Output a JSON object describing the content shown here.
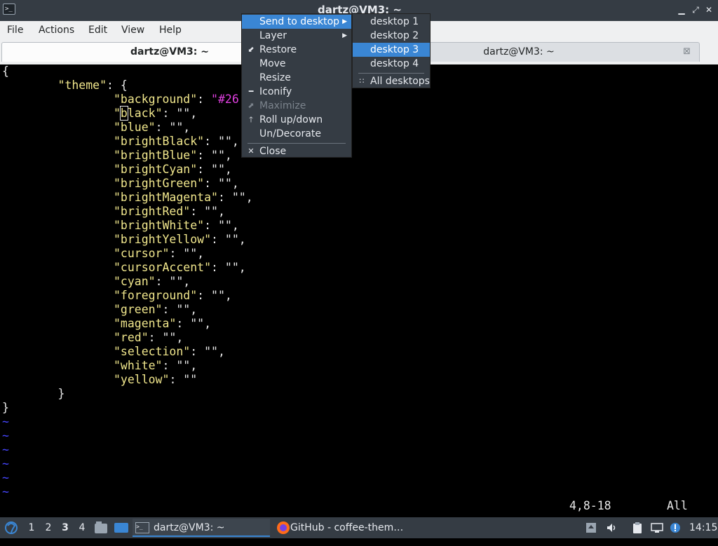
{
  "window": {
    "title": "dartz@VM3: ~",
    "app_icon_text": ">_",
    "controls": {
      "minimize": "▁",
      "maximize": "⤢",
      "close": "✕"
    }
  },
  "menubar": [
    "File",
    "Actions",
    "Edit",
    "View",
    "Help"
  ],
  "tabs": [
    {
      "label": "dartz@VM3: ~",
      "active": true
    },
    {
      "label": "dartz@VM3: ~",
      "active": false,
      "close": "⊠"
    }
  ],
  "editor": {
    "lines": {
      "l0": "{",
      "l1_key": "\"theme\"",
      "l1_rest": ": {",
      "l2_key": "\"background\"",
      "l2_sep": ": ",
      "l2_val": "\"#26",
      "l3_q": "\"",
      "l3_cur": "b",
      "l3_key": "lack\"",
      "l4": "\"blue\"",
      "l5": "\"brightBlack\"",
      "l6": "\"brightBlue\"",
      "l7": "\"brightCyan\"",
      "l8": "\"brightGreen\"",
      "l9": "\"brightMagenta\"",
      "l10": "\"brightRed\"",
      "l11": "\"brightWhite\"",
      "l12": "\"brightYellow\"",
      "l13": "\"cursor\"",
      "l14": "\"cursorAccent\"",
      "l15": "\"cyan\"",
      "l16": "\"foreground\"",
      "l17": "\"green\"",
      "l18": "\"magenta\"",
      "l19": "\"red\"",
      "l20": "\"selection\"",
      "l21": "\"white\"",
      "l22": "\"yellow\"",
      "empty_val": ": \"\",",
      "last_val": ": \"\"",
      "close_inner": "}",
      "close_outer": "}",
      "tilde": "~"
    },
    "status_position": "4,8-18",
    "status_scroll": "All"
  },
  "context_menu": {
    "items": {
      "send": "Send to desktop",
      "layer": "Layer",
      "restore": "Restore",
      "move": "Move",
      "resize": "Resize",
      "iconify": "Iconify",
      "maximize": "Maximize",
      "rollup": "Roll up/down",
      "undecorate": "Un/Decorate",
      "close": "Close"
    },
    "icons": {
      "restore": "⬋",
      "iconify": "━",
      "maximize": "⬈",
      "rollup": "🡑",
      "close": "✕",
      "arrow": "▶"
    }
  },
  "submenu": {
    "items": [
      "desktop 1",
      "desktop 2",
      "desktop 3",
      "desktop 4"
    ],
    "all": "All desktops",
    "highlighted": "desktop 3",
    "all_icon": "∷"
  },
  "taskbar": {
    "workspaces": [
      "1",
      "2",
      "3",
      "4"
    ],
    "current_workspace": "3",
    "tasks": [
      {
        "label": "dartz@VM3: ~",
        "active": true
      },
      {
        "label": "GitHub - coffee-them…",
        "active": false
      }
    ],
    "clock": "14:15"
  },
  "colors": {
    "accent": "#3a86d4",
    "panel_bg": "#353c44",
    "json_key": "#f0e68c",
    "json_string": "#e040e0",
    "vim_tilde": "#4646ff"
  }
}
